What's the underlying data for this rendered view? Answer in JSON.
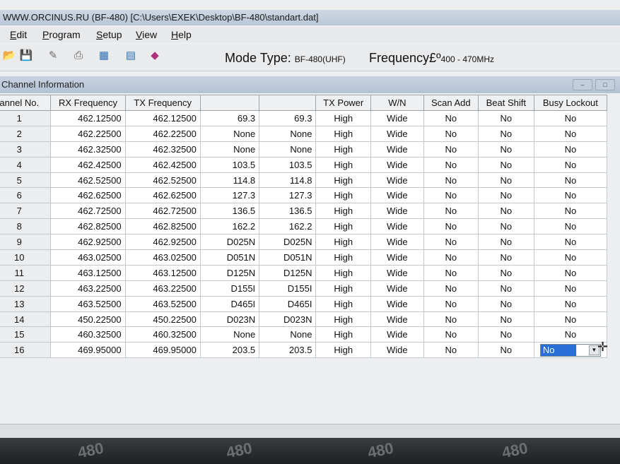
{
  "window": {
    "title": "WWW.ORCINUS.RU (BF-480) [C:\\Users\\EXEK\\Desktop\\BF-480\\standart.dat]"
  },
  "menu": [
    "Edit",
    "Program",
    "Setup",
    "View",
    "Help"
  ],
  "toolbar": {
    "icons": [
      "open-icon",
      "save-icon",
      "edit-icon",
      "print-icon",
      "read-icon",
      "write-icon",
      "erase-icon"
    ]
  },
  "mode": {
    "label": "Mode Type:",
    "value": "BF-480(UHF)"
  },
  "frequency": {
    "label": "Frequency£º",
    "value": "400 - 470MHz"
  },
  "panel": {
    "title": "Channel Information"
  },
  "table": {
    "columns": [
      "annel No.",
      "RX Frequency",
      "TX Frequency",
      "",
      "",
      "TX Power",
      "W/N",
      "Scan Add",
      "Beat Shift",
      "Busy Lockout"
    ],
    "rows": [
      [
        "1",
        "462.12500",
        "462.12500",
        "69.3",
        "69.3",
        "High",
        "Wide",
        "No",
        "No",
        "No"
      ],
      [
        "2",
        "462.22500",
        "462.22500",
        "None",
        "None",
        "High",
        "Wide",
        "No",
        "No",
        "No"
      ],
      [
        "3",
        "462.32500",
        "462.32500",
        "None",
        "None",
        "High",
        "Wide",
        "No",
        "No",
        "No"
      ],
      [
        "4",
        "462.42500",
        "462.42500",
        "103.5",
        "103.5",
        "High",
        "Wide",
        "No",
        "No",
        "No"
      ],
      [
        "5",
        "462.52500",
        "462.52500",
        "114.8",
        "114.8",
        "High",
        "Wide",
        "No",
        "No",
        "No"
      ],
      [
        "6",
        "462.62500",
        "462.62500",
        "127.3",
        "127.3",
        "High",
        "Wide",
        "No",
        "No",
        "No"
      ],
      [
        "7",
        "462.72500",
        "462.72500",
        "136.5",
        "136.5",
        "High",
        "Wide",
        "No",
        "No",
        "No"
      ],
      [
        "8",
        "462.82500",
        "462.82500",
        "162.2",
        "162.2",
        "High",
        "Wide",
        "No",
        "No",
        "No"
      ],
      [
        "9",
        "462.92500",
        "462.92500",
        "D025N",
        "D025N",
        "High",
        "Wide",
        "No",
        "No",
        "No"
      ],
      [
        "10",
        "463.02500",
        "463.02500",
        "D051N",
        "D051N",
        "High",
        "Wide",
        "No",
        "No",
        "No"
      ],
      [
        "11",
        "463.12500",
        "463.12500",
        "D125N",
        "D125N",
        "High",
        "Wide",
        "No",
        "No",
        "No"
      ],
      [
        "12",
        "463.22500",
        "463.22500",
        "D155I",
        "D155I",
        "High",
        "Wide",
        "No",
        "No",
        "No"
      ],
      [
        "13",
        "463.52500",
        "463.52500",
        "D465I",
        "D465I",
        "High",
        "Wide",
        "No",
        "No",
        "No"
      ],
      [
        "14",
        "450.22500",
        "450.22500",
        "D023N",
        "D023N",
        "High",
        "Wide",
        "No",
        "No",
        "No"
      ],
      [
        "15",
        "460.32500",
        "460.32500",
        "None",
        "None",
        "High",
        "Wide",
        "No",
        "No",
        "No"
      ],
      [
        "16",
        "469.95000",
        "469.95000",
        "203.5",
        "203.5",
        "High",
        "Wide",
        "No",
        "No",
        "No"
      ]
    ]
  },
  "bezel_text": "480"
}
